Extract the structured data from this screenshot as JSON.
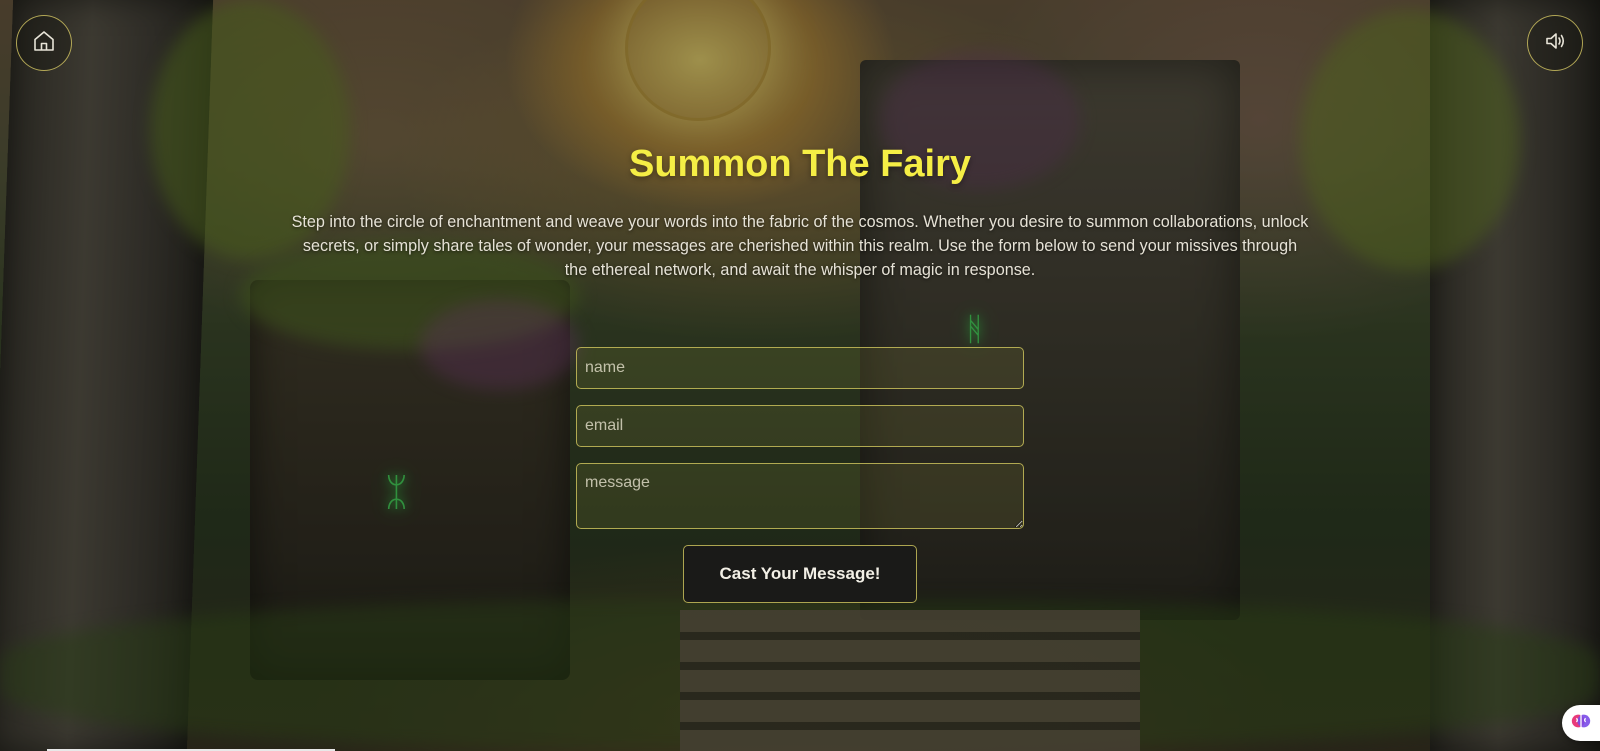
{
  "header": {
    "home_icon": "home-icon",
    "sound_icon": "speaker-icon"
  },
  "main": {
    "title": "Summon The Fairy",
    "intro": "Step into the circle of enchantment and weave your words into the fabric of the cosmos. Whether you desire to summon collaborations, unlock secrets, or simply share tales of wonder, your messages are cherished within this realm. Use the form below to send your missives through the ethereal network, and await the whisper of magic in response."
  },
  "form": {
    "name_placeholder": "name",
    "email_placeholder": "email",
    "message_placeholder": "message",
    "submit_label": "Cast Your Message!"
  },
  "colors": {
    "title": "#f5ee45",
    "border_accent": "#c8be5a",
    "button_bg": "#1a1a18"
  },
  "widget": {
    "icon": "brain-icon"
  }
}
